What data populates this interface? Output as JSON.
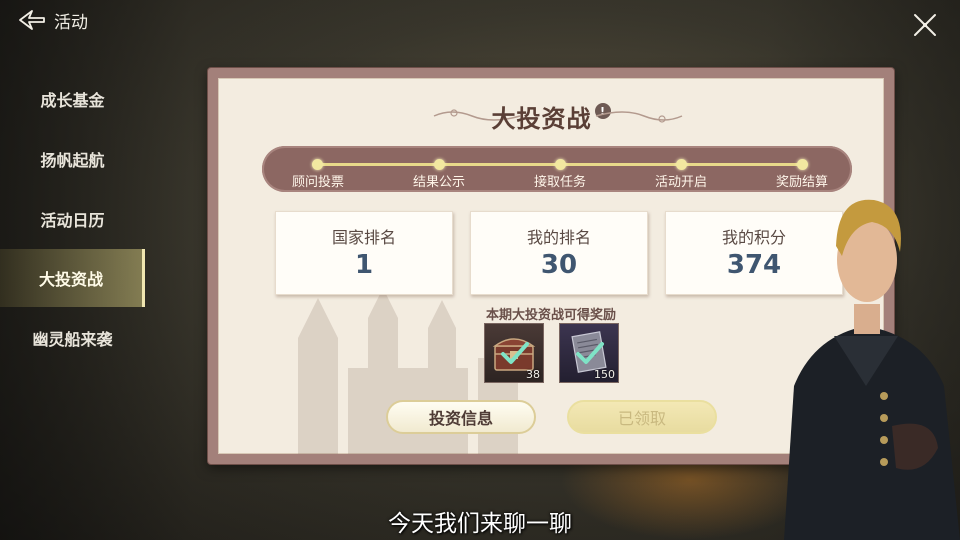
{
  "header": {
    "back_label": "活动"
  },
  "sidebar": {
    "items": [
      {
        "label": "成长基金"
      },
      {
        "label": "扬帆起航"
      },
      {
        "label": "活动日历"
      },
      {
        "label": "大投资战"
      },
      {
        "label": "幽灵船来袭"
      }
    ],
    "active_index": 3
  },
  "panel": {
    "title": "大投资战",
    "info_glyph": "!",
    "timeline": [
      {
        "label": "顾问投票"
      },
      {
        "label": "结果公示"
      },
      {
        "label": "接取任务"
      },
      {
        "label": "活动开启"
      },
      {
        "label": "奖励结算"
      }
    ],
    "stats": [
      {
        "label": "国家排名",
        "value": "1"
      },
      {
        "label": "我的排名",
        "value": "30"
      },
      {
        "label": "我的积分",
        "value": "374"
      }
    ],
    "reward_title": "本期大投资战可得奖励",
    "rewards": [
      {
        "icon": "treasure-chest-icon",
        "count": "38",
        "claimed": true
      },
      {
        "icon": "document-scroll-icon",
        "count": "150",
        "claimed": true
      }
    ],
    "buttons": {
      "info_label": "投资信息",
      "claimed_label": "已领取"
    }
  },
  "subtitle": "今天我们来聊一聊",
  "colors": {
    "panel_border": "#a3807a",
    "timeline_bg": "#8c6762",
    "stat_value": "#3f5670",
    "title": "#5a3f36"
  }
}
